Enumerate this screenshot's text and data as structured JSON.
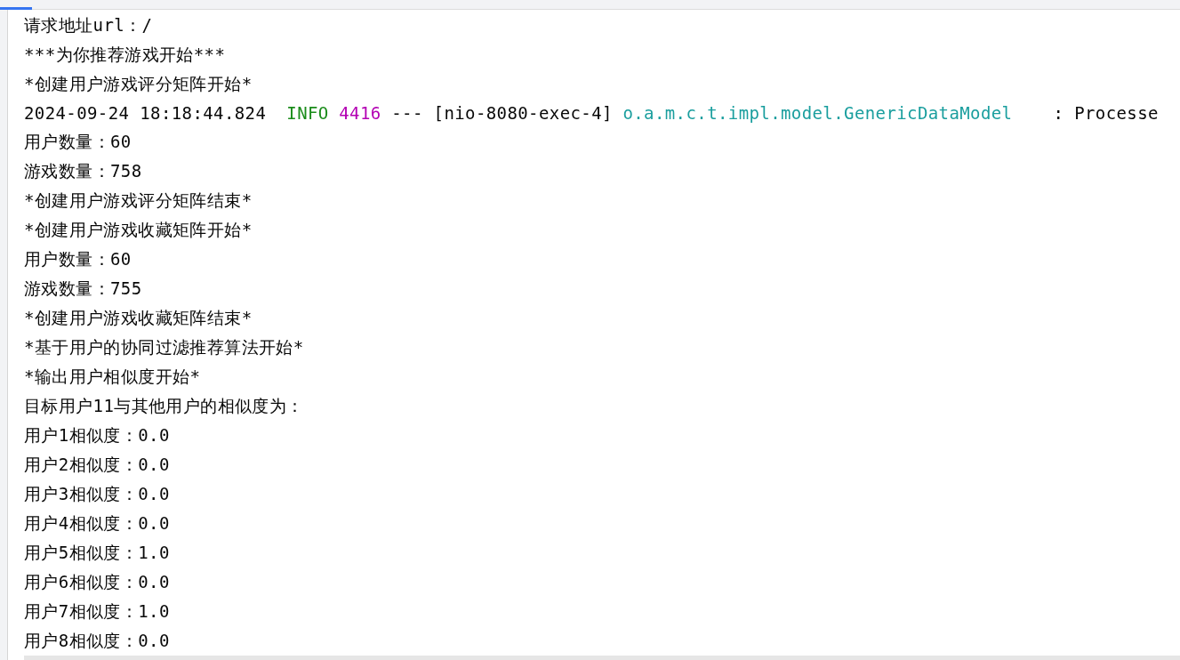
{
  "console": {
    "lines": [
      {
        "kind": "plain",
        "text": "请求地址url：/"
      },
      {
        "kind": "plain",
        "text": "***为你推荐游戏开始***"
      },
      {
        "kind": "plain",
        "text": "*创建用户游戏评分矩阵开始*"
      },
      {
        "kind": "log",
        "segments": [
          {
            "kind": "timestamp",
            "text": "2024-09-24 18:18:44.824"
          },
          {
            "kind": "level",
            "text": "INFO"
          },
          {
            "kind": "pid",
            "text": "4416"
          },
          {
            "kind": "thread",
            "text": "--- [nio-8080-exec-4]"
          },
          {
            "kind": "logger",
            "text": "o.a.m.c.t.impl.model.GenericDataModel"
          },
          {
            "kind": "message",
            "text": ": Processe"
          }
        ]
      },
      {
        "kind": "plain",
        "text": "用户数量：60"
      },
      {
        "kind": "plain",
        "text": "游戏数量：758"
      },
      {
        "kind": "plain",
        "text": "*创建用户游戏评分矩阵结束*"
      },
      {
        "kind": "plain",
        "text": "*创建用户游戏收藏矩阵开始*"
      },
      {
        "kind": "plain",
        "text": "用户数量：60"
      },
      {
        "kind": "plain",
        "text": "游戏数量：755"
      },
      {
        "kind": "plain",
        "text": "*创建用户游戏收藏矩阵结束*"
      },
      {
        "kind": "plain",
        "text": "*基于用户的协同过滤推荐算法开始*"
      },
      {
        "kind": "plain",
        "text": "*输出用户相似度开始*"
      },
      {
        "kind": "plain",
        "text": "目标用户11与其他用户的相似度为："
      },
      {
        "kind": "plain",
        "text": "用户1相似度：0.0"
      },
      {
        "kind": "plain",
        "text": "用户2相似度：0.0"
      },
      {
        "kind": "plain",
        "text": "用户3相似度：0.0"
      },
      {
        "kind": "plain",
        "text": "用户4相似度：0.0"
      },
      {
        "kind": "plain",
        "text": "用户5相似度：1.0"
      },
      {
        "kind": "plain",
        "text": "用户6相似度：0.0"
      },
      {
        "kind": "plain",
        "text": "用户7相似度：1.0"
      },
      {
        "kind": "plain",
        "text": "用户8相似度：0.0"
      }
    ]
  }
}
